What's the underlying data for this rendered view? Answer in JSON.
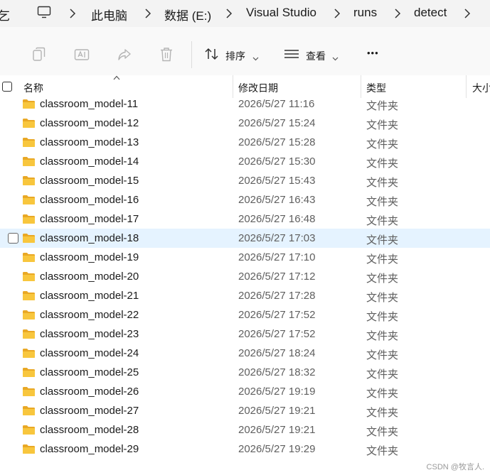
{
  "address_bar": {
    "left_fragment": "乞",
    "crumbs": [
      "此电脑",
      "数据 (E:)",
      "Visual Studio",
      "runs",
      "detect"
    ]
  },
  "toolbar": {
    "sort_label": "排序",
    "view_label": "查看",
    "more_label": "•••"
  },
  "columns": {
    "name": "名称",
    "date": "修改日期",
    "type": "类型",
    "size": "大小"
  },
  "rows": [
    {
      "name": "classroom_model-11",
      "date": "2026/5/27 11:16",
      "type": "文件夹"
    },
    {
      "name": "classroom_model-12",
      "date": "2026/5/27 15:24",
      "type": "文件夹"
    },
    {
      "name": "classroom_model-13",
      "date": "2026/5/27 15:28",
      "type": "文件夹"
    },
    {
      "name": "classroom_model-14",
      "date": "2026/5/27 15:30",
      "type": "文件夹"
    },
    {
      "name": "classroom_model-15",
      "date": "2026/5/27 15:43",
      "type": "文件夹"
    },
    {
      "name": "classroom_model-16",
      "date": "2026/5/27 16:43",
      "type": "文件夹"
    },
    {
      "name": "classroom_model-17",
      "date": "2026/5/27 16:48",
      "type": "文件夹"
    },
    {
      "name": "classroom_model-18",
      "date": "2026/5/27 17:03",
      "type": "文件夹"
    },
    {
      "name": "classroom_model-19",
      "date": "2026/5/27 17:10",
      "type": "文件夹"
    },
    {
      "name": "classroom_model-20",
      "date": "2026/5/27 17:12",
      "type": "文件夹"
    },
    {
      "name": "classroom_model-21",
      "date": "2026/5/27 17:28",
      "type": "文件夹"
    },
    {
      "name": "classroom_model-22",
      "date": "2026/5/27 17:52",
      "type": "文件夹"
    },
    {
      "name": "classroom_model-23",
      "date": "2026/5/27 17:52",
      "type": "文件夹"
    },
    {
      "name": "classroom_model-24",
      "date": "2026/5/27 18:24",
      "type": "文件夹"
    },
    {
      "name": "classroom_model-25",
      "date": "2026/5/27 18:32",
      "type": "文件夹"
    },
    {
      "name": "classroom_model-26",
      "date": "2026/5/27 19:19",
      "type": "文件夹"
    },
    {
      "name": "classroom_model-27",
      "date": "2026/5/27 19:21",
      "type": "文件夹"
    },
    {
      "name": "classroom_model-28",
      "date": "2026/5/27 19:21",
      "type": "文件夹"
    },
    {
      "name": "classroom_model-29",
      "date": "2026/5/27 19:29",
      "type": "文件夹"
    }
  ],
  "selected_row": "classroom_model-18",
  "watermark": "CSDN @牧言人.",
  "colors": {
    "selected_row_bg": "#e5f3ff",
    "folder_yellow": "#f8c63d",
    "secondary_text": "#5f5f5f"
  }
}
